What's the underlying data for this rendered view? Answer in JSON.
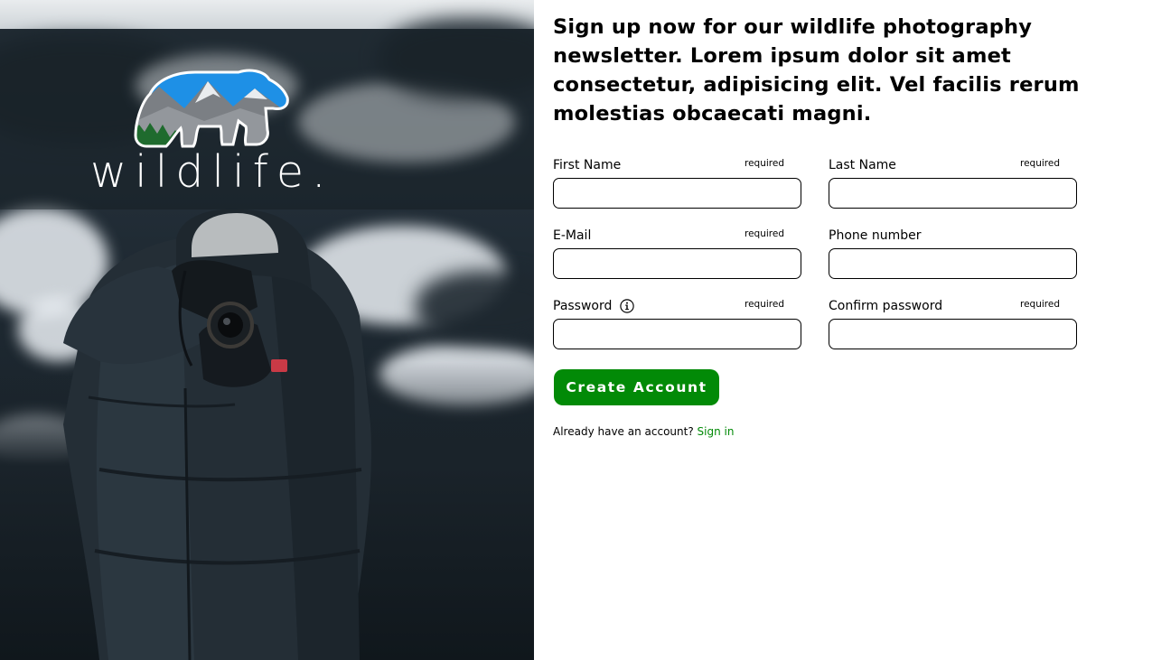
{
  "brand": {
    "logo_text": "wildlife.",
    "logo_icon": "bear-mountain-icon",
    "accent_color": "#028a07",
    "sky_color": "#1e90e6",
    "forest_color": "#1f6b2e"
  },
  "headline": "Sign up now for our wildlife photography newsletter. Lorem ipsum dolor sit amet consectetur, adipisicing elit. Vel facilis rerum molestias obcaecati magni.",
  "form": {
    "first_name": {
      "label": "First Name",
      "required_text": "required",
      "value": ""
    },
    "last_name": {
      "label": "Last Name",
      "required_text": "required",
      "value": ""
    },
    "email": {
      "label": "E-Mail",
      "required_text": "required",
      "value": ""
    },
    "phone": {
      "label": "Phone number",
      "value": ""
    },
    "password": {
      "label": "Password",
      "required_text": "required",
      "value": "",
      "info_icon": "info-icon"
    },
    "confirm_password": {
      "label": "Confirm password",
      "required_text": "required",
      "value": ""
    },
    "submit_label": "Create Account"
  },
  "signin": {
    "prompt": "Already have an account?",
    "link_label": "Sign in"
  }
}
